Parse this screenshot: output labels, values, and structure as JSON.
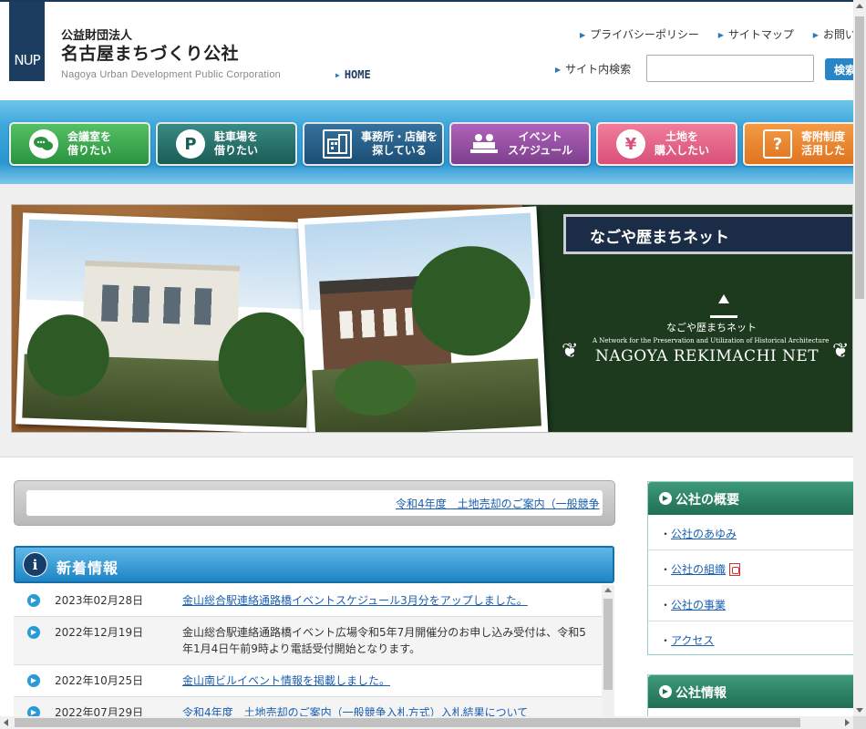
{
  "header": {
    "logo_text": "NUP",
    "org_type": "公益財団法人",
    "org_name": "名古屋まちづくり公社",
    "org_name_en": "Nagoya Urban Development Public Corporation",
    "home_label": "HOME",
    "top_links": [
      "プライバシーポリシー",
      "サイトマップ",
      "お問い"
    ],
    "search_label": "サイト内検索",
    "search_value": "",
    "search_button": "検索"
  },
  "nav": [
    {
      "line1": "会議室を",
      "line2": "借りたい",
      "icon": "speech-bubbles-icon",
      "color": "#2a9340"
    },
    {
      "line1": "駐車場を",
      "line2": "借りたい",
      "icon": "parking-icon",
      "icon_char": "P",
      "color": "#1b5c56"
    },
    {
      "line1": "事務所・店舗を",
      "line2": "探している",
      "icon": "building-icon",
      "color": "#1d4e76"
    },
    {
      "line1": "イベント",
      "line2": "スケジュール",
      "icon": "event-people-icon",
      "color": "#7d3f8e"
    },
    {
      "line1": "土地を",
      "line2": "購入したい",
      "icon": "yen-person-icon",
      "icon_char": "¥",
      "color": "#d94f77"
    },
    {
      "line1": "寄附制度",
      "line2": "活用した",
      "icon": "question-docs-icon",
      "icon_char": "?",
      "color": "#e07420"
    }
  ],
  "banner": {
    "title": "なごや歴まちネット",
    "logo_jp": "なごや歴まちネット",
    "logo_en_small": "A Network for the Preservation and Utilization of Historical Architecture",
    "logo_en_big": "NAGOYA REKIMACHI NET"
  },
  "ticker": {
    "text": "令和4年度　土地売却のご案内（一般競争"
  },
  "news": {
    "title": "新着情報",
    "items": [
      {
        "date": "2023年02月28日",
        "text": "金山総合駅連絡通路橋イベントスケジュール3月分をアップしました。",
        "link": true
      },
      {
        "date": "2022年12月19日",
        "text": "金山総合駅連絡通路橋イベント広場令和5年7月開催分のお申し込み受付は、令和5年1月4日午前9時より電話受付開始となります。",
        "link": false
      },
      {
        "date": "2022年10月25日",
        "text": "金山南ビルイベント情報を掲載しました。",
        "link": true
      },
      {
        "date": "2022年07月29日",
        "text": "令和4年度　土地売却のご案内（一般競争入札方式）入札結果について",
        "link": true
      }
    ]
  },
  "sidebar": {
    "overview_title": "公社の概要",
    "overview_items": [
      "公社のあゆみ",
      "公社の組織",
      "公社の事業",
      "アクセス"
    ],
    "info_title": "公社情報"
  }
}
